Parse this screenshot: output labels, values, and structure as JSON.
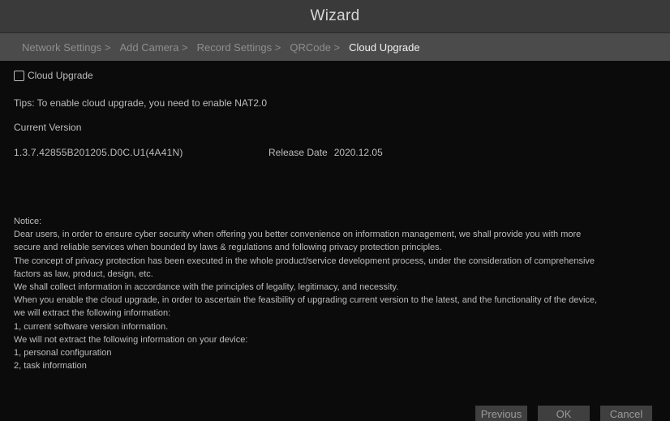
{
  "window": {
    "title": "Wizard"
  },
  "steps": [
    {
      "label": "Network Settings >"
    },
    {
      "label": "Add Camera >"
    },
    {
      "label": "Record Settings >"
    },
    {
      "label": "QRCode >"
    },
    {
      "label": "Cloud Upgrade"
    }
  ],
  "cloud_upgrade": {
    "checkbox_label": "Cloud Upgrade",
    "checked": false,
    "tips": "Tips: To enable cloud upgrade, you need to enable NAT2.0",
    "current_version_label": "Current Version",
    "version": "1.3.7.42855B201205.D0C.U1(4A41N)",
    "release_date_label": "Release Date",
    "release_date": "2020.12.05"
  },
  "notice": {
    "lines": [
      "Notice:",
      "Dear users, in order to ensure cyber security when offering you better convenience on information management, we shall provide you with more",
      "secure and reliable services when bounded by laws & regulations and following privacy protection principles.",
      "The concept of privacy protection has been executed in the whole product/service development process, under the consideration of comprehensive",
      "factors as law, product, design, etc.",
      "We shall collect information in accordance with the principles of legality, legitimacy, and necessity.",
      "When you enable the cloud upgrade, in order to ascertain the feasibility of upgrading current version to the latest, and the functionality of the device,",
      "we will extract the following information:",
      "1, current software version information.",
      "We will not extract the following information on your device:",
      "1, personal configuration",
      "2, task information"
    ]
  },
  "buttons": {
    "previous": "Previous",
    "ok": "OK",
    "cancel": "Cancel"
  },
  "colors": {
    "title_bar": "#3a3a3a",
    "steps_bar": "#4b4b4b",
    "background": "#0b0b0b",
    "active_step": "#f2f2f2",
    "inactive_step": "#8e8e8e",
    "button": "#3f3f3f"
  }
}
